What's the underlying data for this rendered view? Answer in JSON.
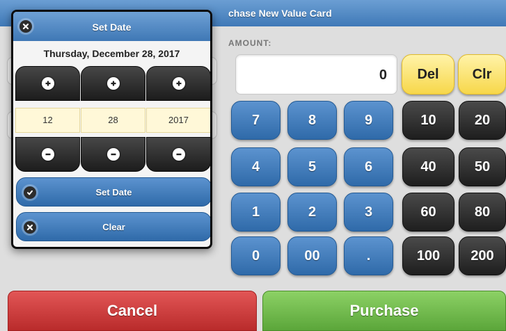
{
  "page": {
    "title": "Purchase New Value Card",
    "title_visible": "chase New Value Card",
    "amount_label": "AMOUNT:",
    "amount_value": "0"
  },
  "keypad": {
    "del": "Del",
    "clr": "Clr",
    "digits": [
      "7",
      "8",
      "9",
      "4",
      "5",
      "6",
      "1",
      "2",
      "3",
      "0",
      "00",
      "."
    ],
    "presets": [
      "10",
      "20",
      "40",
      "50",
      "60",
      "80",
      "100",
      "200"
    ]
  },
  "actions": {
    "cancel": "Cancel",
    "purchase": "Purchase"
  },
  "date_popup": {
    "title": "Set Date",
    "full_date": "Thursday, December 28, 2017",
    "month": "12",
    "day": "28",
    "year": "2017",
    "set_date_label": "Set Date",
    "clear_label": "Clear"
  },
  "icons": {
    "close": "close-icon",
    "plus": "plus-icon",
    "minus": "minus-icon",
    "check": "check-icon"
  },
  "colors": {
    "header_blue": "#3f79b7",
    "key_blue": "#2f6aa9",
    "key_dark": "#1e1e1e",
    "key_yellow": "#f7d74a",
    "cancel_red": "#b92b2b",
    "purchase_green": "#5ba63a"
  }
}
